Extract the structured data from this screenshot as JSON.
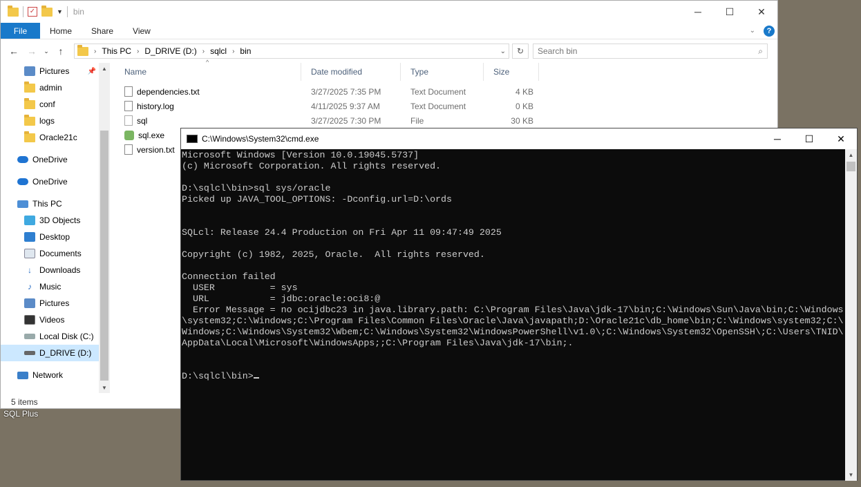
{
  "desktop": {
    "label": "SQL Plus"
  },
  "explorer": {
    "title": "bin",
    "ribbon": {
      "file": "File",
      "home": "Home",
      "share": "Share",
      "view": "View"
    },
    "path": [
      "This PC",
      "D_DRIVE (D:)",
      "sqlcl",
      "bin"
    ],
    "search_placeholder": "Search bin",
    "nav_items": [
      {
        "label": "Pictures",
        "icon": "pictures-icon"
      },
      {
        "label": "admin",
        "icon": "folder-icon"
      },
      {
        "label": "conf",
        "icon": "folder-icon"
      },
      {
        "label": "logs",
        "icon": "folder-icon"
      },
      {
        "label": "Oracle21c",
        "icon": "folder-icon"
      },
      {
        "label": "OneDrive",
        "icon": "cloud-icon"
      },
      {
        "label": "OneDrive",
        "icon": "cloud-icon"
      },
      {
        "label": "This PC",
        "icon": "computer-icon"
      },
      {
        "label": "3D Objects",
        "icon": "cube-icon"
      },
      {
        "label": "Desktop",
        "icon": "desktop-icon"
      },
      {
        "label": "Documents",
        "icon": "documents-icon"
      },
      {
        "label": "Downloads",
        "icon": "download-icon"
      },
      {
        "label": "Music",
        "icon": "music-icon"
      },
      {
        "label": "Pictures",
        "icon": "pictures-icon"
      },
      {
        "label": "Videos",
        "icon": "video-icon"
      },
      {
        "label": "Local Disk (C:)",
        "icon": "drive-icon"
      },
      {
        "label": "D_DRIVE (D:)",
        "icon": "drive-icon"
      },
      {
        "label": "Network",
        "icon": "network-icon"
      }
    ],
    "columns": {
      "name": "Name",
      "date": "Date modified",
      "type": "Type",
      "size": "Size"
    },
    "files": [
      {
        "name": "dependencies.txt",
        "date": "3/27/2025 7:35 PM",
        "type": "Text Document",
        "size": "4 KB"
      },
      {
        "name": "history.log",
        "date": "4/11/2025 9:37 AM",
        "type": "Text Document",
        "size": "0 KB"
      },
      {
        "name": "sql",
        "date": "3/27/2025 7:30 PM",
        "type": "File",
        "size": "30 KB"
      },
      {
        "name": "sql.exe",
        "date": "",
        "type": "",
        "size": ""
      },
      {
        "name": "version.txt",
        "date": "",
        "type": "",
        "size": ""
      }
    ],
    "status": "5 items"
  },
  "cmd": {
    "title": "C:\\Windows\\System32\\cmd.exe",
    "output": "Microsoft Windows [Version 10.0.19045.5737]\n(c) Microsoft Corporation. All rights reserved.\n\nD:\\sqlcl\\bin>sql sys/oracle\nPicked up JAVA_TOOL_OPTIONS: -Dconfig.url=D:\\ords\n\n\nSQLcl: Release 24.4 Production on Fri Apr 11 09:47:49 2025\n\nCopyright (c) 1982, 2025, Oracle.  All rights reserved.\n\nConnection failed\n  USER          = sys\n  URL           = jdbc:oracle:oci8:@\n  Error Message = no ocijdbc23 in java.library.path: C:\\Program Files\\Java\\jdk-17\\bin;C:\\Windows\\Sun\\Java\\bin;C:\\Windows\n\\system32;C:\\Windows;C:\\Program Files\\Common Files\\Oracle\\Java\\javapath;D:\\Oracle21c\\db_home\\bin;C:\\Windows\\system32;C:\\\nWindows;C:\\Windows\\System32\\Wbem;C:\\Windows\\System32\\WindowsPowerShell\\v1.0\\;C:\\Windows\\System32\\OpenSSH\\;C:\\Users\\TNID\\\nAppData\\Local\\Microsoft\\WindowsApps;;C:\\Program Files\\Java\\jdk-17\\bin;.\n\n\nD:\\sqlcl\\bin>"
  }
}
